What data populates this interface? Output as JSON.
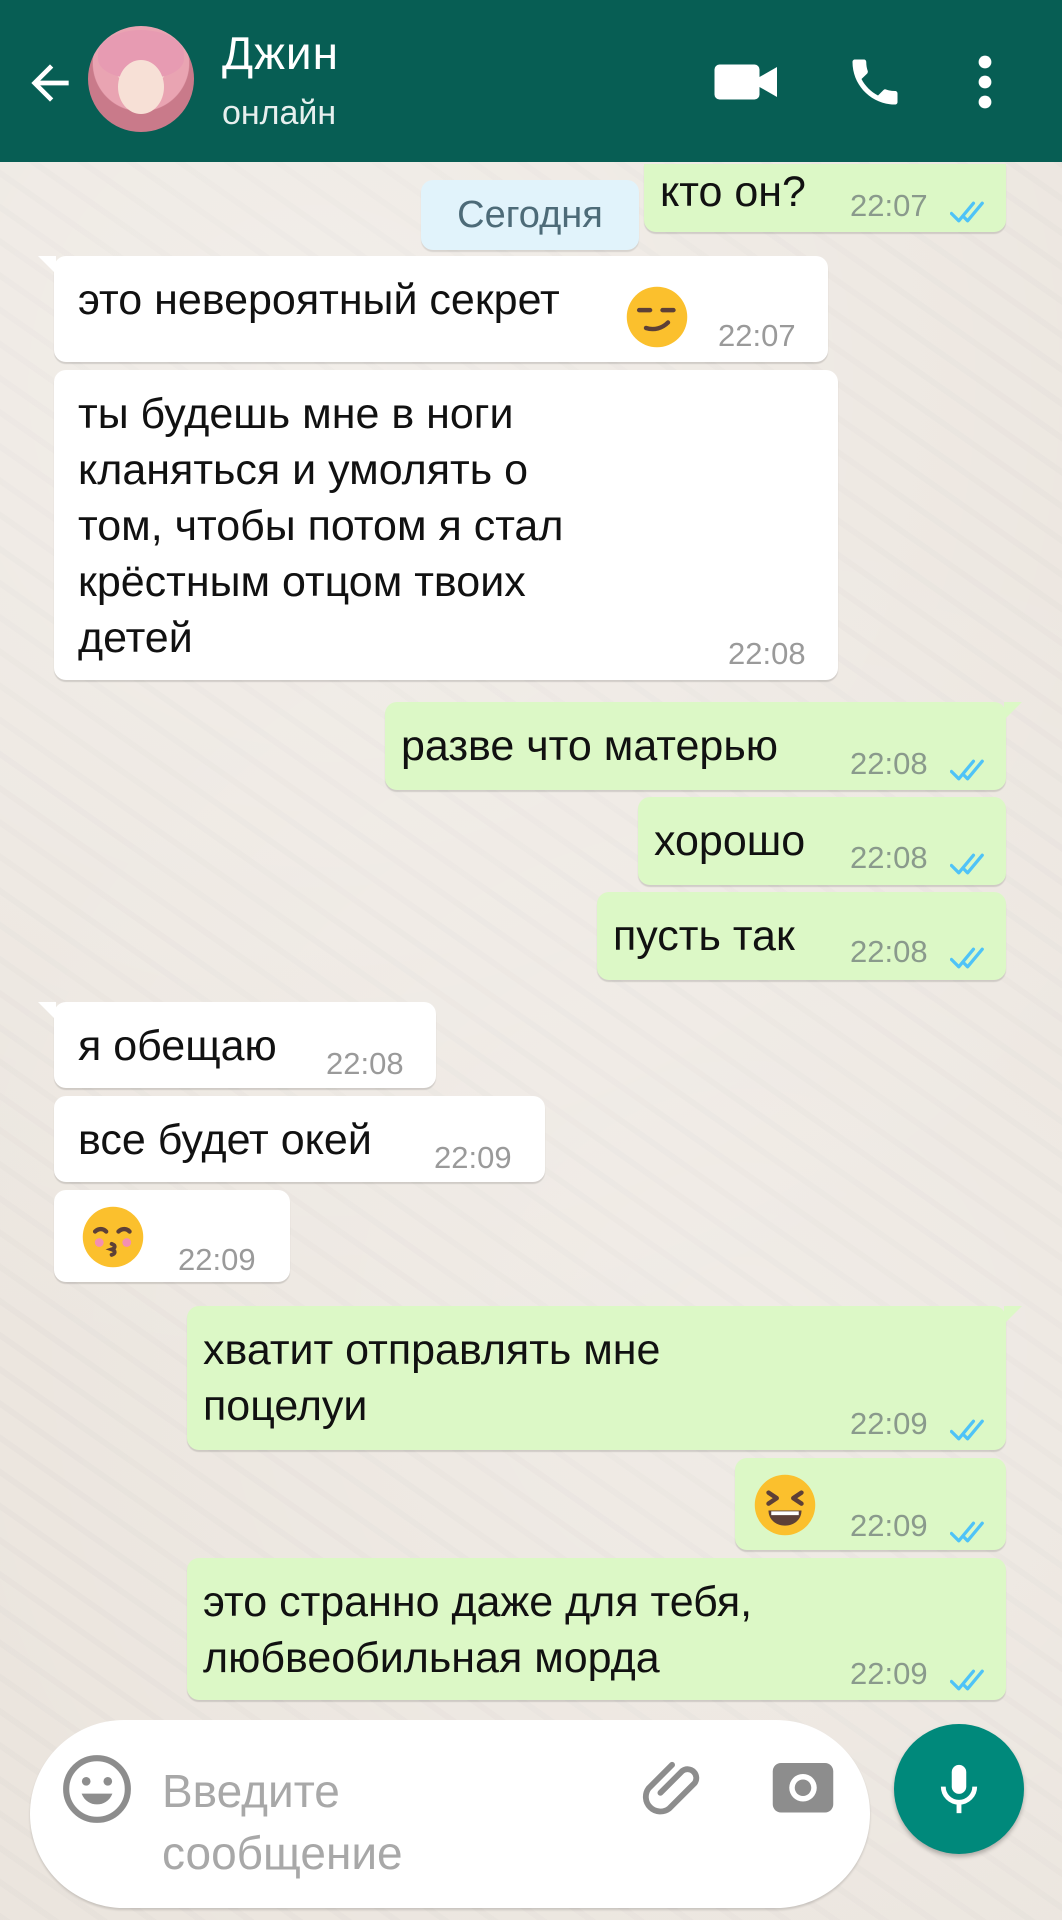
{
  "header": {
    "contact_name": "Джин",
    "status": "онлайн"
  },
  "chat": {
    "date_separator": "Сегодня",
    "messages": [
      {
        "dir": "out",
        "text": "кто он?",
        "time": "22:07",
        "ticks": "read"
      },
      {
        "dir": "in",
        "text": "это невероятный секрет",
        "emoji": "smirk",
        "time": "22:07"
      },
      {
        "dir": "in",
        "text": "ты будешь мне в ноги\nкланяться и умолять о\nтом, чтобы потом я стал\nкрёстным отцом твоих\nдетей",
        "time": "22:08"
      },
      {
        "dir": "out",
        "text": "разве что матерью",
        "time": "22:08",
        "ticks": "read"
      },
      {
        "dir": "out",
        "text": "хорошо",
        "time": "22:08",
        "ticks": "read"
      },
      {
        "dir": "out",
        "text": "пусть так",
        "time": "22:08",
        "ticks": "read"
      },
      {
        "dir": "in",
        "text": "я обещаю",
        "time": "22:08"
      },
      {
        "dir": "in",
        "text": "все будет окей",
        "time": "22:09"
      },
      {
        "dir": "in",
        "text": "",
        "emoji": "kissing-closed-eyes",
        "time": "22:09"
      },
      {
        "dir": "out",
        "text": "хватит отправлять мне\nпоцелуи",
        "time": "22:09",
        "ticks": "read"
      },
      {
        "dir": "out",
        "text": "",
        "emoji": "grinning-squinting",
        "time": "22:09",
        "ticks": "read"
      },
      {
        "dir": "out",
        "text": "это странно даже для тебя,\nлюбвеобильная морда",
        "time": "22:09",
        "ticks": "read"
      }
    ]
  },
  "composer": {
    "placeholder": "Введите\nсообщение"
  },
  "colors": {
    "header": "#075e54",
    "outgoing_bubble": "#dcf8c6",
    "incoming_bubble": "#ffffff",
    "read_ticks": "#4fc3f7",
    "mic_button": "#00897b"
  },
  "icons": [
    "back-arrow-icon",
    "video-call-icon",
    "phone-icon",
    "more-vert-icon",
    "emoji-icon",
    "attach-icon",
    "camera-icon",
    "mic-icon"
  ]
}
